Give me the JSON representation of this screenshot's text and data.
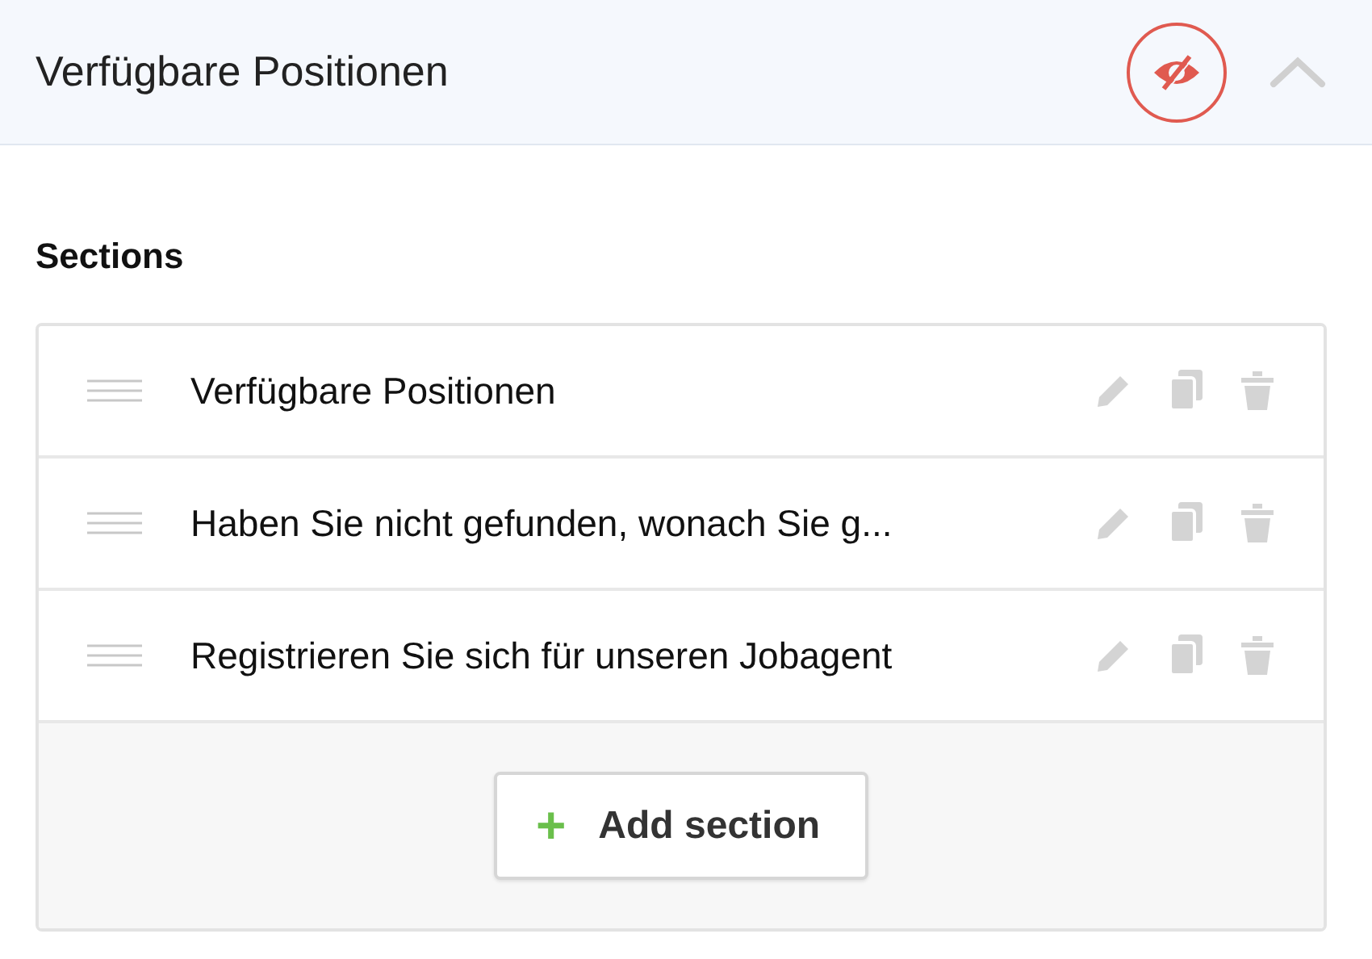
{
  "panel": {
    "title": "Verfügbare Positionen",
    "visible": false,
    "expanded": true
  },
  "sections_label": "Sections",
  "sections": [
    {
      "title": "Verfügbare Positionen"
    },
    {
      "title": "Haben Sie nicht gefunden, wonach Sie g..."
    },
    {
      "title": "Registrieren Sie sich für unseren Jobagent"
    }
  ],
  "add_button": {
    "label": "Add section",
    "icon": "+"
  }
}
